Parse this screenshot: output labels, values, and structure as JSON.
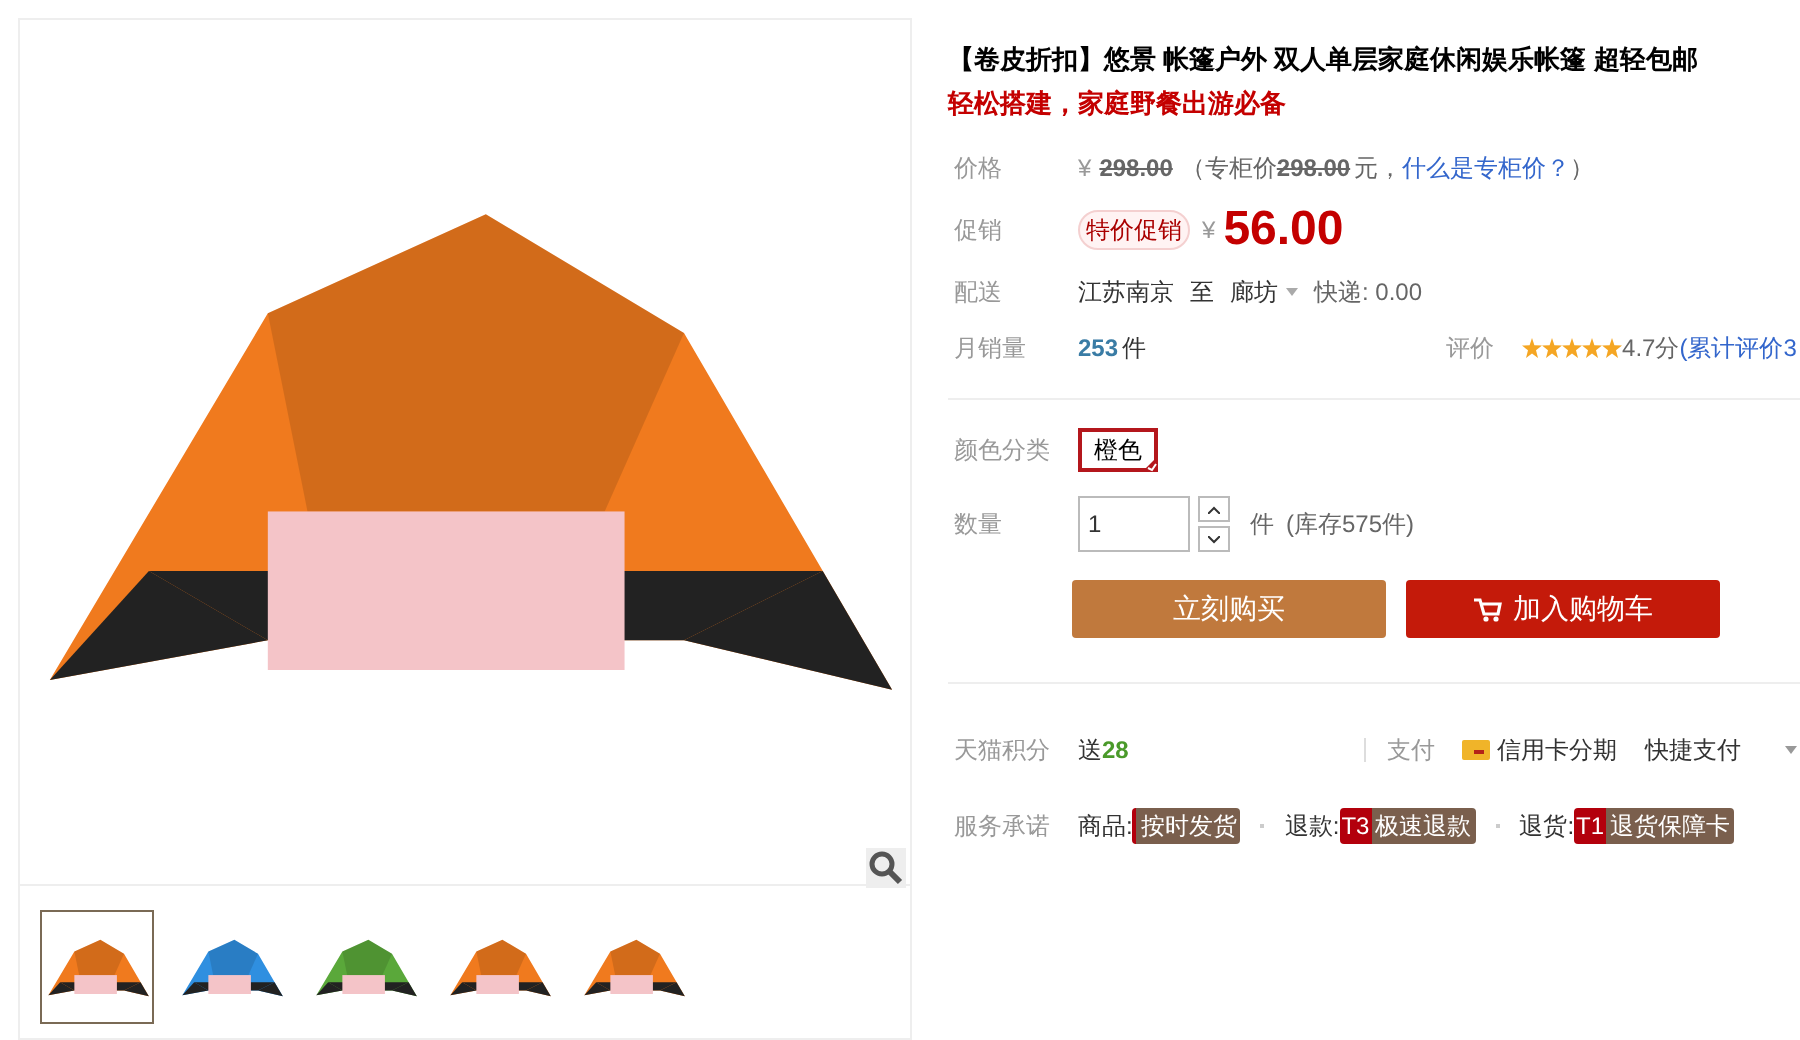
{
  "gallery": {
    "thumbnails": [
      {
        "selected": true,
        "color": "#f07a1e"
      },
      {
        "selected": false,
        "color": "#2f8fe0"
      },
      {
        "selected": false,
        "color": "#5aa83a"
      },
      {
        "selected": false,
        "color": "#f07a1e"
      },
      {
        "selected": false,
        "color": "#f07a1e"
      }
    ]
  },
  "title": "【卷皮折扣】悠景 帐篷户外 双人单层家庭休闲娱乐帐篷 超轻包邮",
  "subtitle": "轻松搭建，家庭野餐出游必备",
  "price": {
    "label": "价格",
    "currency": "¥",
    "value": "298.00",
    "counter_open": "（专柜价",
    "counter_value": "298.00",
    "counter_close": "元，",
    "link": "什么是专柜价？",
    "close": "）"
  },
  "promo": {
    "label": "促销",
    "tag": "特价促销",
    "currency": "¥",
    "value": "56.00"
  },
  "delivery": {
    "label": "配送",
    "from": "江苏南京",
    "to_word": "至",
    "to": "廊坊",
    "shipping": "快递: 0.00"
  },
  "sales": {
    "label": "月销量",
    "count": "253",
    "unit": "件"
  },
  "rating": {
    "label": "评价",
    "stars": 5,
    "score": "4.7分",
    "link": "(累计评价3"
  },
  "color_options": {
    "label": "颜色分类",
    "options": [
      {
        "label": "橙色",
        "selected": true
      }
    ]
  },
  "quantity": {
    "label": "数量",
    "value": "1",
    "unit": "件",
    "stock": "(库存575件)"
  },
  "buttons": [
    {
      "kind": "buy",
      "label": "立刻购买"
    },
    {
      "kind": "cart",
      "label": "加入购物车"
    }
  ],
  "points": {
    "label": "天猫积分",
    "prefix": "送",
    "value": "28"
  },
  "payment": {
    "label": "支付",
    "methods": [
      {
        "kind": "card",
        "label": "信用卡分期"
      },
      {
        "kind": "plain",
        "label": "快捷支付"
      }
    ]
  },
  "service": {
    "label": "服务承诺",
    "items": [
      {
        "prefix": "商品:",
        "tag": "按时发货"
      },
      {
        "prefix": "退款:",
        "badge": "T3",
        "tag": "极速退款"
      },
      {
        "prefix": "退货:",
        "badge": "T1",
        "tag": "退货保障卡"
      }
    ]
  }
}
